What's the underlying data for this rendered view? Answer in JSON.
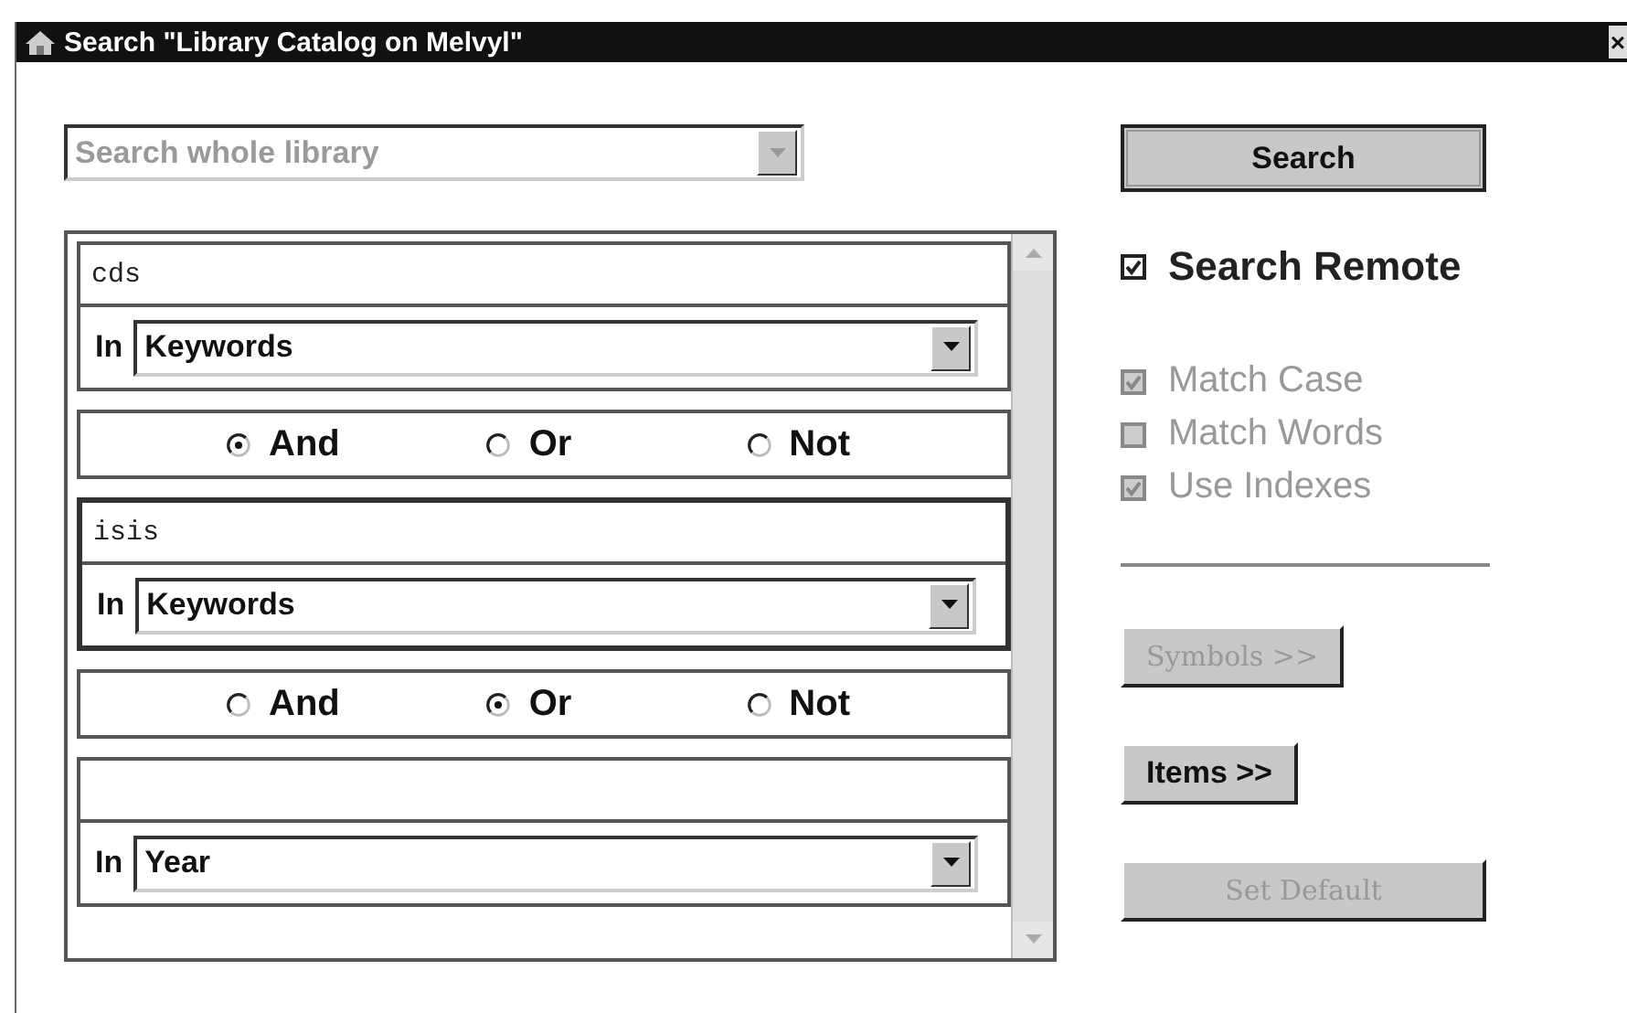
{
  "window": {
    "title": "Search \"Library Catalog on Melvyl\"",
    "close": "×"
  },
  "scope": {
    "value": "Search whole library",
    "disabled": true
  },
  "queries": [
    {
      "term": "cds",
      "field_label": "In",
      "field": "Keywords",
      "focused": false,
      "operators": [
        {
          "label": "And",
          "selected": true
        },
        {
          "label": "Or",
          "selected": false
        },
        {
          "label": "Not",
          "selected": false
        }
      ]
    },
    {
      "term": "isis",
      "field_label": "In",
      "field": "Keywords",
      "focused": true,
      "operators": [
        {
          "label": "And",
          "selected": false
        },
        {
          "label": "Or",
          "selected": true
        },
        {
          "label": "Not",
          "selected": false
        }
      ]
    },
    {
      "field_label": "In",
      "field": "Year",
      "focused": false
    }
  ],
  "search_button": {
    "label": "Search"
  },
  "options": [
    {
      "kind": "primary",
      "label": "Search Remote",
      "checked": true,
      "disabled": false
    },
    {
      "kind": "option",
      "label": "Match Case",
      "checked": true,
      "disabled": true
    },
    {
      "kind": "option",
      "label": "Match Words",
      "checked": false,
      "disabled": true
    },
    {
      "kind": "option",
      "label": "Use Indexes",
      "checked": true,
      "disabled": true
    }
  ],
  "buttons": [
    {
      "label": "Symbols >>",
      "disabled": true
    },
    {
      "label": "Items >>",
      "disabled": false
    },
    {
      "label": "Set Default",
      "disabled": true
    }
  ]
}
